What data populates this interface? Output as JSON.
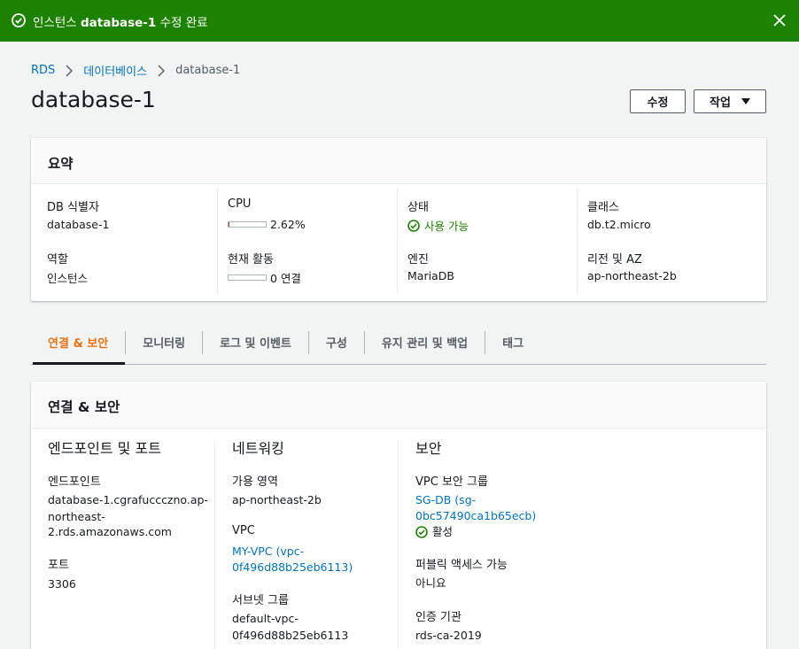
{
  "flash": {
    "prefix": "인스턴스 ",
    "name": "database-1",
    "suffix": " 수정 완료",
    "color": "#1d8102"
  },
  "breadcrumb": [
    "RDS",
    "데이터베이스",
    "database-1"
  ],
  "page_title": "database-1",
  "buttons": {
    "edit": "수정",
    "actions": "작업"
  },
  "summary": {
    "title": "요약",
    "db_id_label": "DB 식별자",
    "db_id_value": "database-1",
    "role_label": "역할",
    "role_value": "인스턴스",
    "cpu_label": "CPU",
    "cpu_value": "2.62%",
    "cpu_fraction": 0.0262,
    "activity_label": "현재 활동",
    "activity_value": "0 연결",
    "status_label": "상태",
    "status_value": "사용 가능",
    "engine_label": "엔진",
    "engine_value": "MariaDB",
    "class_label": "클래스",
    "class_value": "db.t2.micro",
    "region_label": "리전 및 AZ",
    "region_value": "ap-northeast-2b"
  },
  "tabs": [
    "연결 & 보안",
    "모니터링",
    "로그 및 이벤트",
    "구성",
    "유지 관리 및 백업",
    "태그"
  ],
  "connectivity": {
    "title": "연결 & 보안",
    "endpoint_col": {
      "title": "엔드포인트 및 포트",
      "endpoint_label": "엔드포인트",
      "endpoint_line1": "database-1.cgrafuccczno.ap-",
      "endpoint_line2": "northeast-",
      "endpoint_line3": "2.rds.amazonaws.com",
      "port_label": "포트",
      "port_value": "3306"
    },
    "network_col": {
      "title": "네트워킹",
      "az_label": "가용 영역",
      "az_value": "ap-northeast-2b",
      "vpc_label": "VPC",
      "vpc_line1": "MY-VPC (vpc-",
      "vpc_line2": "0f496d88b25eb6113)",
      "subnet_label": "서브넷 그룹",
      "subnet_line1": "default-vpc-",
      "subnet_line2": "0f496d88b25eb6113"
    },
    "security_col": {
      "title": "보안",
      "sg_label": "VPC 보안 그룹",
      "sg_line1": "SG-DB (sg-",
      "sg_line2": "0bc57490ca1b65ecb)",
      "sg_status": "활성",
      "public_label": "퍼블릭 액세스 가능",
      "public_value": "아니요",
      "ca_label": "인증 기관",
      "ca_value": "rds-ca-2019"
    }
  }
}
